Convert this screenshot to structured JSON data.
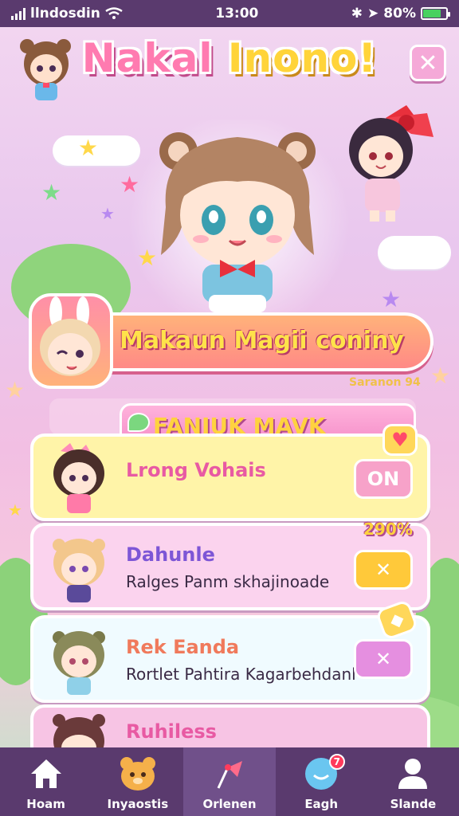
{
  "status_bar": {
    "carrier": "llndosdin",
    "time": "13:00",
    "battery": "80%",
    "battery_level": 0.8
  },
  "header": {
    "title_part1": "Nakal ",
    "title_part2": "Inono!",
    "close_icon": "close-icon"
  },
  "banner": {
    "text": "Makaun Magii coniny",
    "subtext": "Saranon 94"
  },
  "ranking": {
    "title": "FANIUK MAVK"
  },
  "list": [
    {
      "name": "Lrong Vohais",
      "desc": "",
      "button": "ON",
      "color": "#fff4a8",
      "button_color": "#f7a2c9",
      "name_color": "#e85aa3"
    },
    {
      "name": "Dahunle",
      "desc": "Ralges Panm skhajinoade",
      "button": "✕",
      "color": "#fbd3ee",
      "button_color": "#ffc93a",
      "name_color": "#7d56d6"
    },
    {
      "name": "Rek Eanda",
      "desc": "Rortlet Pahtira Kagarbehdanl",
      "button": "✕",
      "color": "#f0fbff",
      "button_color": "#e58fe0",
      "name_color": "#f07a5c"
    },
    {
      "name": "Ruhiless",
      "desc": "",
      "button": "",
      "color": "#f7c4e4",
      "button_color": "#f7a2c9",
      "name_color": "#e85aa3"
    }
  ],
  "badges": {
    "percent": "290%"
  },
  "nav": [
    {
      "label": "Hoam",
      "icon": "home-icon"
    },
    {
      "label": "Inyaostis",
      "icon": "bear-icon"
    },
    {
      "label": "Orlenen",
      "icon": "flag-icon"
    },
    {
      "label": "Eagh",
      "icon": "bubble-icon",
      "badge": "7"
    },
    {
      "label": "Slande",
      "icon": "person-icon"
    }
  ],
  "colors": {
    "status_bg": "#5a3a6e",
    "accent_pink": "#ff7bb0",
    "accent_yellow": "#ffd43a"
  }
}
